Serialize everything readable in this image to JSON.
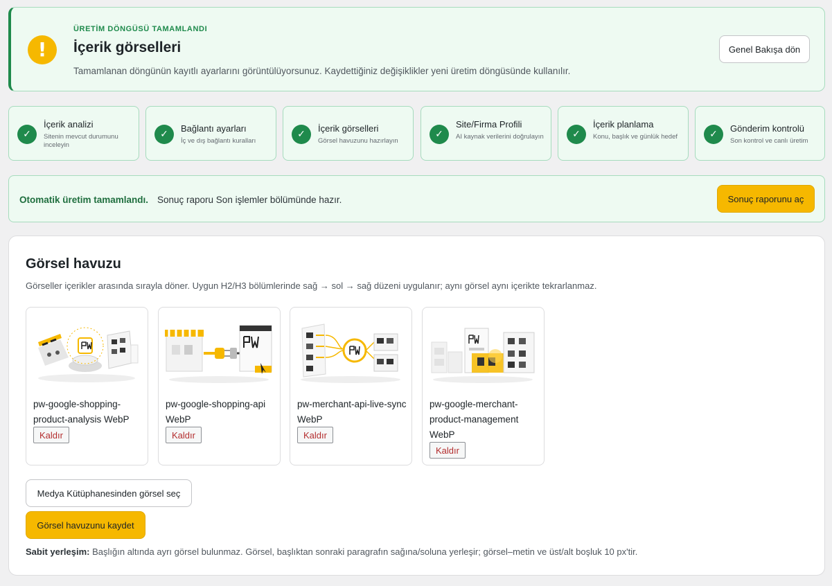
{
  "hero": {
    "warning_glyph": "!",
    "eyebrow": "ÜRETİM DÖNGÜSÜ TAMAMLANDI",
    "title": "İçerik görselleri",
    "description": "Tamamlanan döngünün kayıtlı ayarlarını görüntülüyorsunuz. Kaydettiğiniz değişiklikler yeni üretim döngüsünde kullanılır.",
    "back_button": "Genel Bakışa dön"
  },
  "steps": [
    {
      "title": "İçerik analizi",
      "subtitle": "Sitenin mevcut durumunu inceleyin",
      "status": "completed"
    },
    {
      "title": "Bağlantı ayarları",
      "subtitle": "İç ve dış bağlantı kuralları",
      "status": "completed"
    },
    {
      "title": "İçerik görselleri",
      "subtitle": "Görsel havuzunu hazırlayın",
      "status": "completed"
    },
    {
      "title": "Site/Firma Profili",
      "subtitle": "AI kaynak verilerini doğrulayın",
      "status": "completed"
    },
    {
      "title": "İçerik planlama",
      "subtitle": "Konu, başlık ve günlük hedef",
      "status": "completed"
    },
    {
      "title": "Gönderim kontrolü",
      "subtitle": "Son kontrol ve canlı üretim",
      "status": "completed"
    }
  ],
  "notice": {
    "strong": "Otomatik üretim tamamlandı.",
    "message": "Sonuç raporu Son işlemler bölümünde hazır.",
    "button": "Sonuç raporunu aç"
  },
  "pool": {
    "title": "Görsel havuzu",
    "description": "Görseller içerikler arasında sırayla döner. Uygun H2/H3 bölümlerinde sağ → sol → sağ düzeni uygulanır; aynı görsel aynı içerikte tekrarlanmaz.",
    "images": [
      {
        "name": "pw-google-shopping-product-analysis WebP",
        "remove_label": "Kaldır"
      },
      {
        "name": "pw-google-shopping-api WebP",
        "remove_label": "Kaldır"
      },
      {
        "name": "pw-merchant-api-live-sync WebP",
        "remove_label": "Kaldır"
      },
      {
        "name": "pw-google-merchant-product-management WebP",
        "remove_label": "Kaldır"
      }
    ],
    "media_button": "Medya Kütüphanesinden görsel seç",
    "save_button": "Görsel havuzunu kaydet",
    "footer_label": "Sabit yerleşim:",
    "footer_text": " Başlığın altında ayrı görsel bulunmaz. Görsel, başlıktan sonraki paragrafın sağına/soluna yerleşir; görsel–metin ve üst/alt boşluk 10 px'tir."
  },
  "colors": {
    "accent_green": "#1f8a4c",
    "accent_yellow": "#f6b800",
    "danger_red": "#b32d2e"
  }
}
